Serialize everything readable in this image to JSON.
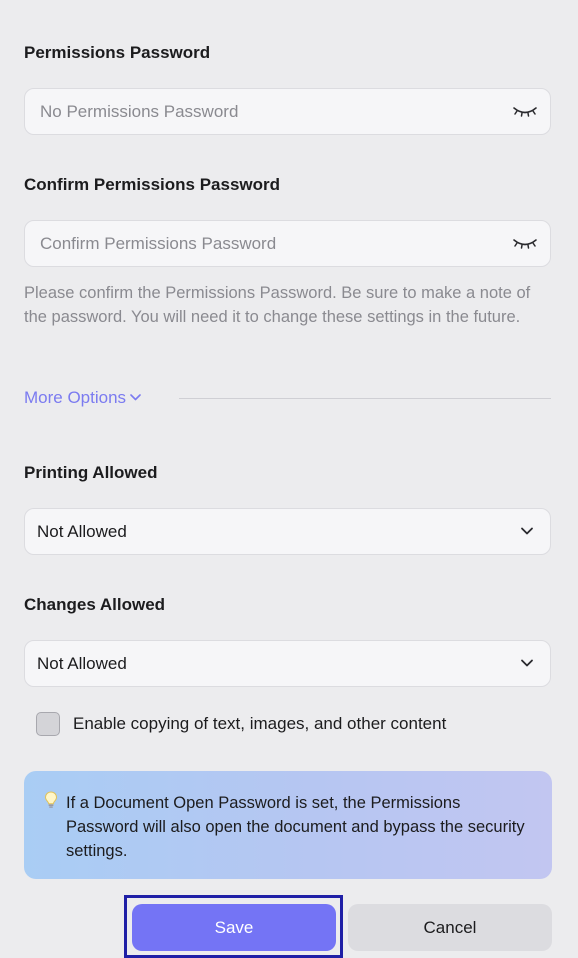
{
  "permissions_password": {
    "label": "Permissions Password",
    "placeholder": "No Permissions Password",
    "toggle_icon": "eye-closed-icon"
  },
  "confirm_password": {
    "label": "Confirm Permissions Password",
    "placeholder": "Confirm Permissions Password",
    "toggle_icon": "eye-closed-icon",
    "help": "Please confirm the Permissions Password. Be sure to make a note of the password. You will need it to change these settings in the future."
  },
  "more_options": {
    "label": "More Options",
    "icon": "chevron-down-icon",
    "color": "#7b7bf0"
  },
  "printing": {
    "label": "Printing Allowed",
    "value": "Not Allowed"
  },
  "changes": {
    "label": "Changes Allowed",
    "value": "Not Allowed"
  },
  "copying": {
    "label": "Enable copying of text, images, and other content",
    "checked": false
  },
  "info": {
    "icon": "lightbulb-icon",
    "text": "If a Document Open Password is set, the Permissions Password will also open the document and bypass the security settings."
  },
  "buttons": {
    "save": "Save",
    "cancel": "Cancel",
    "save_color": "#7474f5",
    "highlight_color": "#1f1fa6"
  }
}
